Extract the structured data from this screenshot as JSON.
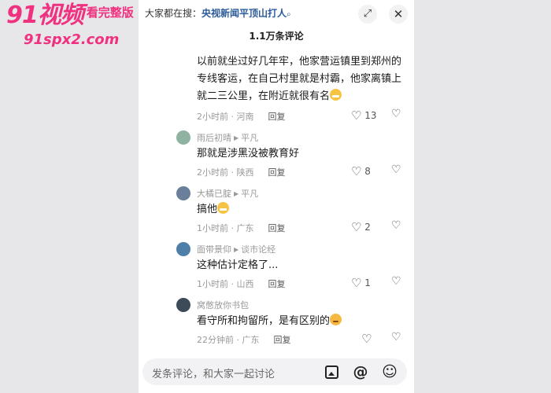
{
  "watermark": {
    "logo": "91视频",
    "tag": "看完整版",
    "url": "91spx2.com"
  },
  "header": {
    "search_prefix": "大家都在搜：",
    "search_term": "央视新闻平顶山打人",
    "search_icon": "search-icon",
    "expand_icon": "expand-icon",
    "close_icon": "close-icon",
    "comment_count": "1.1万条评论"
  },
  "comments": [
    {
      "text": "以前就坐过好几年牢，他家营运镇里到郑州的专线客运，在自己村里就是村霸，他家离镇上就二三公里，在附近就很有名",
      "emoji": "grin",
      "time": "2小时前",
      "location": "河南",
      "reply": "回复",
      "likes": "13"
    },
    {
      "author": "雨后初晴",
      "reply_to": "平凡",
      "avatar_color": "#8fb3a0",
      "text": "那就是涉黑没被教育好",
      "time": "2小时前",
      "location": "陕西",
      "reply": "回复",
      "likes": "8"
    },
    {
      "author": "大橘已腚",
      "reply_to": "平凡",
      "avatar_color": "#6a7f9a",
      "text": "搞他",
      "emoji": "grin",
      "time": "1小时前",
      "location": "广东",
      "reply": "回复",
      "likes": "2"
    },
    {
      "author": "面带景仰",
      "reply_to": "谈市论经",
      "avatar_color": "#4d7fa8",
      "text": "这种估计定格了...",
      "time": "1小时前",
      "location": "山西",
      "reply": "回复",
      "likes": "1"
    },
    {
      "author": "窝憋放你书包",
      "avatar_color": "#3d4a57",
      "text": "看守所和拘留所，是有区别的",
      "emoji": "wink",
      "time": "22分钟前",
      "location": "广东",
      "reply": "回复",
      "likes": ""
    }
  ],
  "meta_sep": " · ",
  "input": {
    "placeholder": "发条评论，和大家一起讨论",
    "image_icon": "image-icon",
    "at_icon": "at-icon",
    "emoji_icon": "emoji-icon"
  }
}
